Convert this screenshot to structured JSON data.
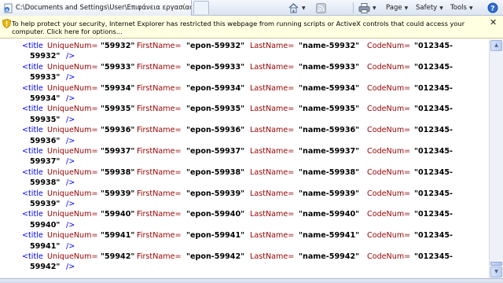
{
  "window": {
    "tab_title": "C:\\Documents and Settings\\User\\Επιφάνεια εργασίας\\..."
  },
  "toolbar": {
    "page_label": "Page",
    "safety_label": "Safety",
    "tools_label": "Tools"
  },
  "infobar": {
    "message": "To help protect your security, Internet Explorer has restricted this webpage from running scripts or ActiveX controls that could access your computer. Click here for options..."
  },
  "xml": {
    "tag_open": "<title",
    "tag_close": "/>",
    "unique_attr": "UniqueNum=",
    "first_attr": "FirstName=",
    "last_attr": "LastName=",
    "code_attr": "CodeNum=",
    "code_prefix": "\"012345-",
    "records": [
      {
        "unique": "\"59932\"",
        "first": "\"epon-59932\"",
        "last": "\"name-59932\"",
        "code_tail": "59932\""
      },
      {
        "unique": "\"59933\"",
        "first": "\"epon-59933\"",
        "last": "\"name-59933\"",
        "code_tail": "59933\""
      },
      {
        "unique": "\"59934\"",
        "first": "\"epon-59934\"",
        "last": "\"name-59934\"",
        "code_tail": "59934\""
      },
      {
        "unique": "\"59935\"",
        "first": "\"epon-59935\"",
        "last": "\"name-59935\"",
        "code_tail": "59935\""
      },
      {
        "unique": "\"59936\"",
        "first": "\"epon-59936\"",
        "last": "\"name-59936\"",
        "code_tail": "59936\""
      },
      {
        "unique": "\"59937\"",
        "first": "\"epon-59937\"",
        "last": "\"name-59937\"",
        "code_tail": "59937\""
      },
      {
        "unique": "\"59938\"",
        "first": "\"epon-59938\"",
        "last": "\"name-59938\"",
        "code_tail": "59938\""
      },
      {
        "unique": "\"59939\"",
        "first": "\"epon-59939\"",
        "last": "\"name-59939\"",
        "code_tail": "59939\""
      },
      {
        "unique": "\"59940\"",
        "first": "\"epon-59940\"",
        "last": "\"name-59940\"",
        "code_tail": "59940\""
      },
      {
        "unique": "\"59941\"",
        "first": "\"epon-59941\"",
        "last": "\"name-59941\"",
        "code_tail": "59941\""
      },
      {
        "unique": "\"59942\"",
        "first": "\"epon-59942\"",
        "last": "\"name-59942\"",
        "code_tail": "59942\""
      }
    ]
  },
  "icons": {
    "tab": "ie-page-icon",
    "home": "home-icon",
    "feeds": "rss-feed-icon",
    "print": "print-icon",
    "security": "security-shield-icon",
    "close_infobar": "close-icon"
  },
  "colors": {
    "xml_markup": "#0000ff",
    "xml_attribute": "#990000",
    "xml_value": "#000000",
    "infobar_bg": "#ffffe1"
  }
}
